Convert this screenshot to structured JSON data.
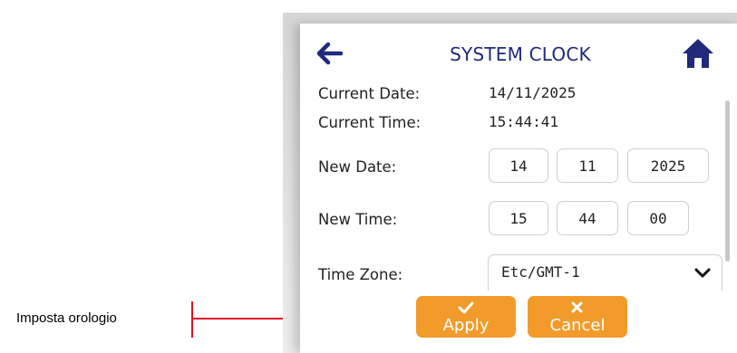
{
  "annotation": {
    "label": "Imposta orologio"
  },
  "header": {
    "title": "SYSTEM CLOCK",
    "back_icon": "arrow-left-icon",
    "home_icon": "home-icon"
  },
  "current": {
    "date_label": "Current Date:",
    "date_value": "14/11/2025",
    "time_label": "Current Time:",
    "time_value": "15:44:41"
  },
  "new_date": {
    "label": "New Date:",
    "day": "14",
    "month": "11",
    "year": "2025"
  },
  "new_time": {
    "label": "New Time:",
    "hour": "15",
    "minute": "44",
    "second": "00"
  },
  "time_zone": {
    "label": "Time Zone:",
    "value": "Etc/GMT-1"
  },
  "buttons": {
    "apply": "Apply",
    "cancel": "Cancel"
  },
  "colors": {
    "accent": "#f29b2a",
    "title": "#1f2a7a",
    "annotation": "#e0102a"
  }
}
